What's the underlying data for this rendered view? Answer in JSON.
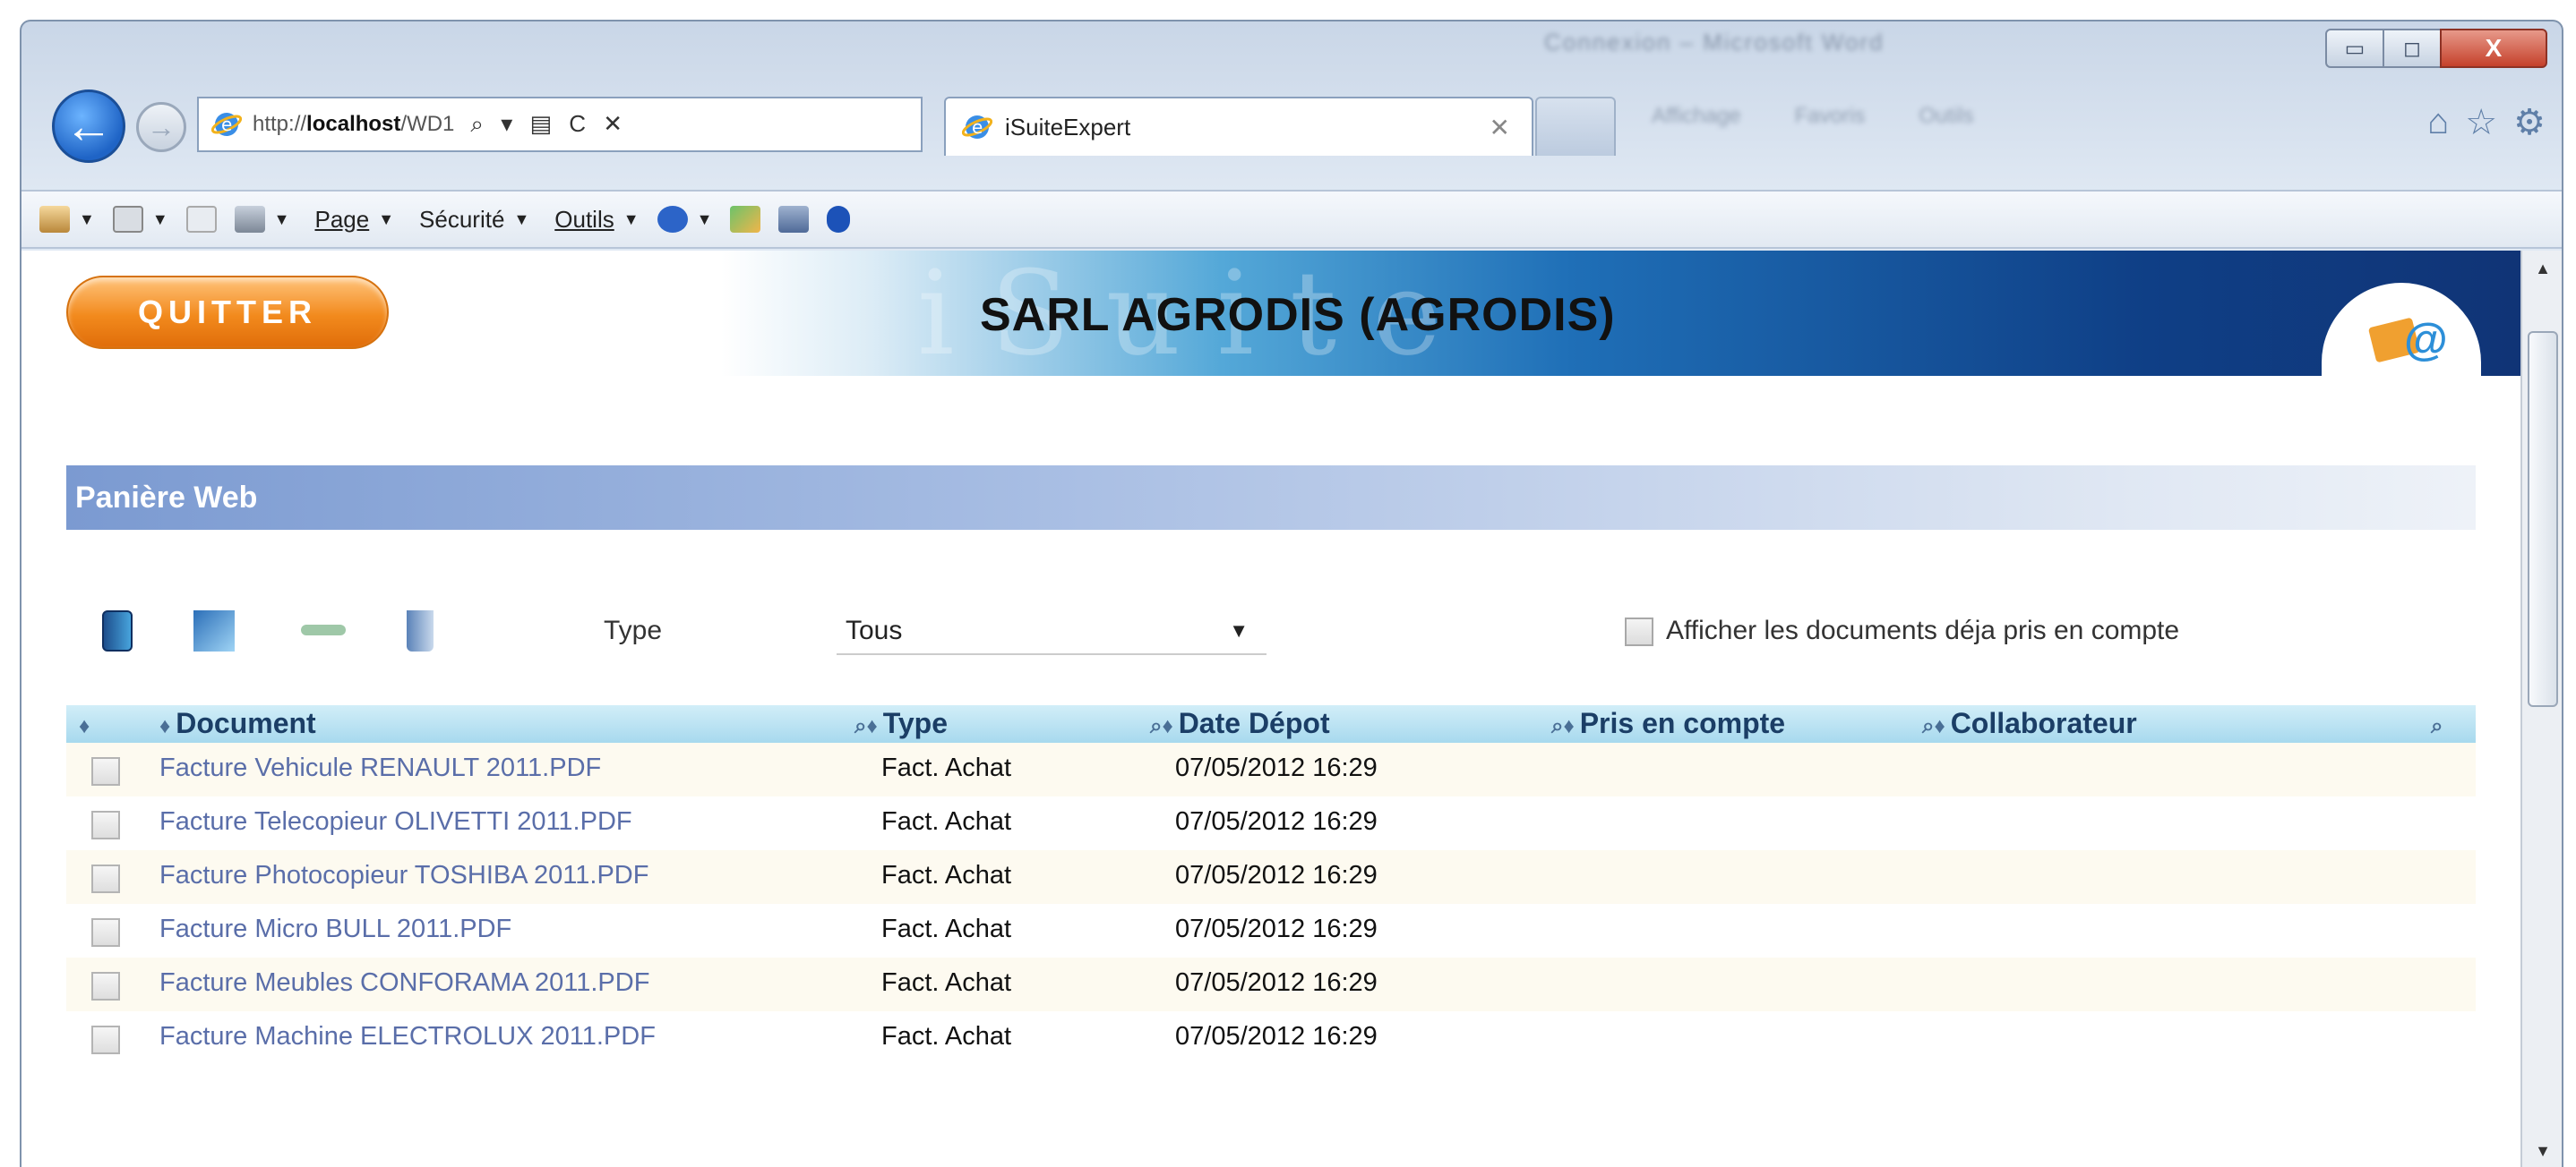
{
  "window": {
    "controls": {
      "minimize": "▭",
      "maximize": "◻",
      "close": "X"
    },
    "blurred_title": "Connexion – Microsoft Word"
  },
  "nav": {
    "url_prefix": "http://",
    "url_host": "localhost",
    "url_rest": "/WD1",
    "url_tools": "⌕ ▾ ▤ C ✕",
    "tab_title": "iSuiteExpert",
    "tab_close": "✕",
    "blurred_tabs": [
      "Affichage",
      "Favoris",
      "Outils"
    ],
    "right_icons": [
      "⌂",
      "☆",
      "⚙"
    ]
  },
  "cmdbar": {
    "page": "Page",
    "securite": "Sécurité",
    "outils": "Outils"
  },
  "header": {
    "quit_label": "QUITTER",
    "company": "SARL AGRODIS (AGRODIS)",
    "watermark": "iSuite"
  },
  "panel_title": "Panière Web",
  "filters": {
    "type_label": "Type",
    "type_value": "Tous",
    "show_taken_label": "Afficher les documents déja pris en compte",
    "show_taken_checked": false
  },
  "table": {
    "columns": {
      "document": "Document",
      "type": "Type",
      "date": "Date Dépot",
      "pris": "Pris en compte",
      "collab": "Collaborateur"
    },
    "rows": [
      {
        "document": "Facture Vehicule RENAULT 2011.PDF",
        "type": "Fact. Achat",
        "date": "07/05/2012 16:29"
      },
      {
        "document": "Facture Telecopieur OLIVETTI 2011.PDF",
        "type": "Fact. Achat",
        "date": "07/05/2012 16:29"
      },
      {
        "document": "Facture Photocopieur TOSHIBA 2011.PDF",
        "type": "Fact. Achat",
        "date": "07/05/2012 16:29"
      },
      {
        "document": "Facture Micro BULL 2011.PDF",
        "type": "Fact. Achat",
        "date": "07/05/2012 16:29"
      },
      {
        "document": "Facture Meubles CONFORAMA 2011.PDF",
        "type": "Fact. Achat",
        "date": "07/05/2012 16:29"
      },
      {
        "document": "Facture Machine ELECTROLUX 2011.PDF",
        "type": "Fact. Achat",
        "date": "07/05/2012 16:29"
      }
    ]
  }
}
